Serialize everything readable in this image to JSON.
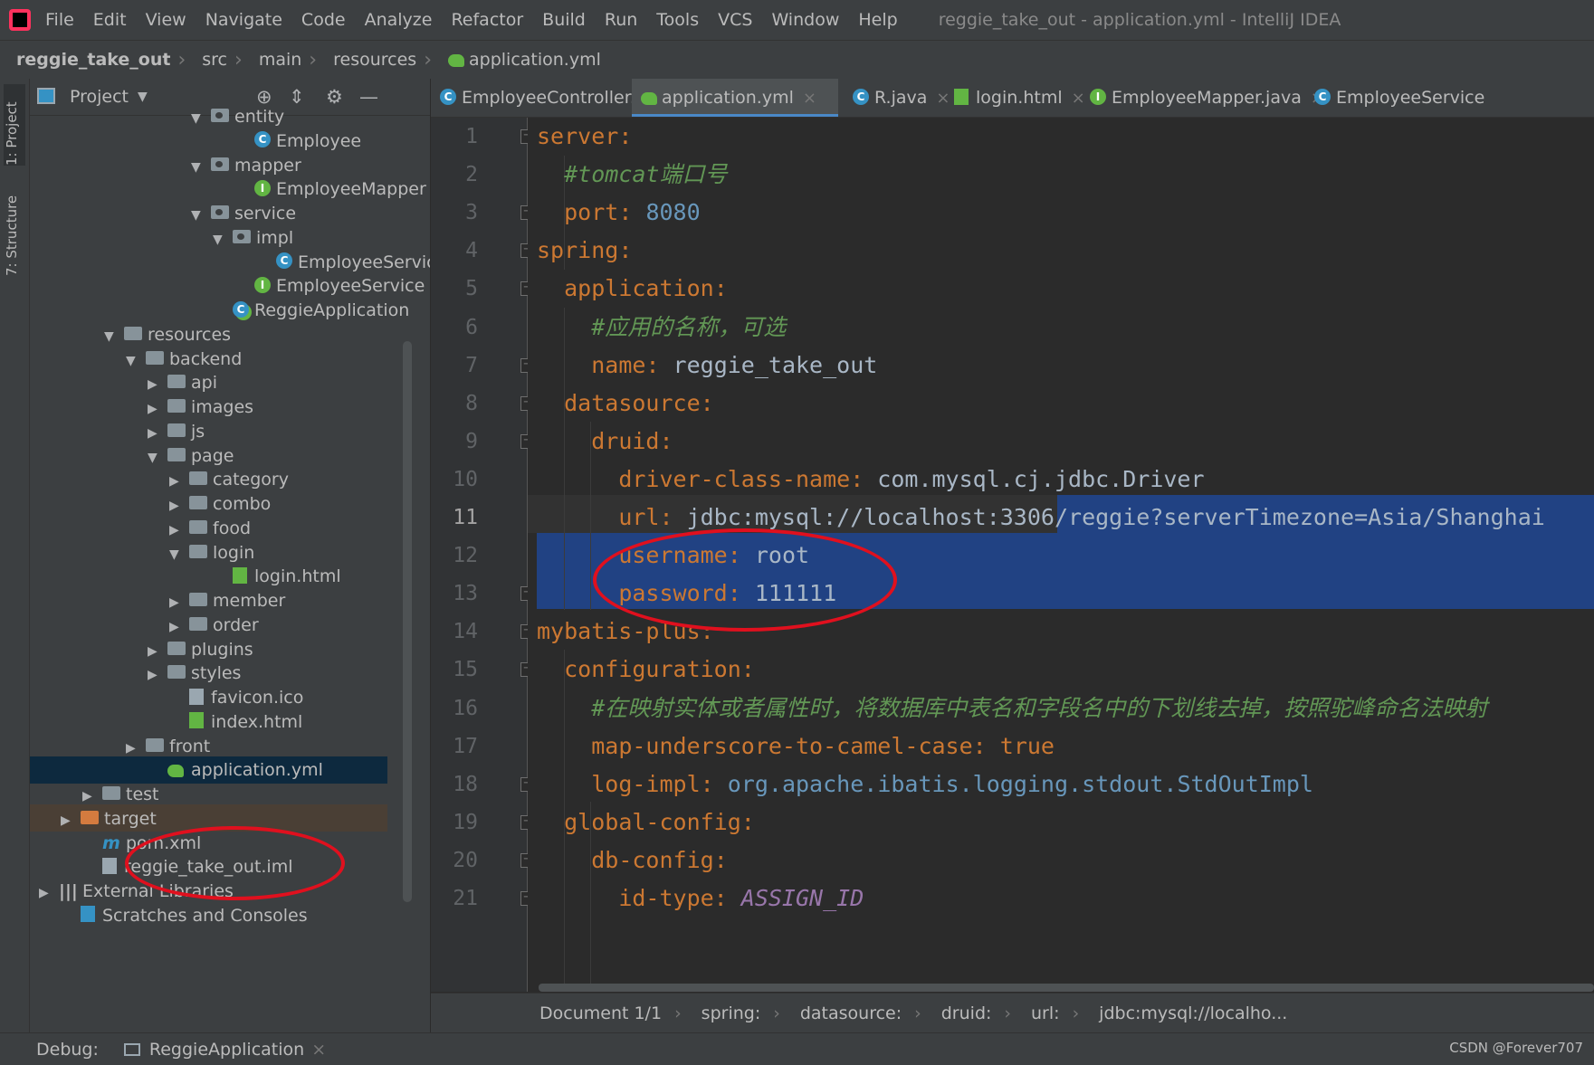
{
  "menubar": {
    "items": [
      "File",
      "Edit",
      "View",
      "Navigate",
      "Code",
      "Analyze",
      "Refactor",
      "Build",
      "Run",
      "Tools",
      "VCS",
      "Window",
      "Help"
    ],
    "window_title": "reggie_take_out - application.yml - IntelliJ IDEA"
  },
  "breadcrumbs": [
    "reggie_take_out",
    "src",
    "main",
    "resources",
    "application.yml"
  ],
  "side_tabs": {
    "project": "1: Project",
    "structure": "7: Structure"
  },
  "project_panel": {
    "title": "Project",
    "tree": [
      {
        "label": "entity",
        "icon": "package-icon",
        "expanded": true
      },
      {
        "label": "Employee",
        "icon": "class-icon"
      },
      {
        "label": "mapper",
        "icon": "package-icon",
        "expanded": true
      },
      {
        "label": "EmployeeMapper",
        "icon": "interface-icon"
      },
      {
        "label": "service",
        "icon": "package-icon",
        "expanded": true
      },
      {
        "label": "impl",
        "icon": "package-icon",
        "expanded": true
      },
      {
        "label": "EmployeeServic",
        "icon": "class-icon"
      },
      {
        "label": "EmployeeService",
        "icon": "interface-icon"
      },
      {
        "label": "ReggieApplication",
        "icon": "spring-class-icon"
      },
      {
        "label": "resources",
        "icon": "folder-icon",
        "expanded": true
      },
      {
        "label": "backend",
        "icon": "folder-icon",
        "expanded": true
      },
      {
        "label": "api",
        "icon": "folder-icon",
        "expanded": false
      },
      {
        "label": "images",
        "icon": "folder-icon",
        "expanded": false
      },
      {
        "label": "js",
        "icon": "folder-icon",
        "expanded": false
      },
      {
        "label": "page",
        "icon": "folder-icon",
        "expanded": true
      },
      {
        "label": "category",
        "icon": "folder-icon",
        "expanded": false
      },
      {
        "label": "combo",
        "icon": "folder-icon",
        "expanded": false
      },
      {
        "label": "food",
        "icon": "folder-icon",
        "expanded": false
      },
      {
        "label": "login",
        "icon": "folder-icon",
        "expanded": true
      },
      {
        "label": "login.html",
        "icon": "html-file-icon"
      },
      {
        "label": "member",
        "icon": "folder-icon",
        "expanded": false
      },
      {
        "label": "order",
        "icon": "folder-icon",
        "expanded": false
      },
      {
        "label": "plugins",
        "icon": "folder-icon",
        "expanded": false
      },
      {
        "label": "styles",
        "icon": "folder-icon",
        "expanded": false
      },
      {
        "label": "favicon.ico",
        "icon": "file-icon"
      },
      {
        "label": "index.html",
        "icon": "html-file-icon"
      },
      {
        "label": "front",
        "icon": "folder-icon",
        "expanded": false
      },
      {
        "label": "application.yml",
        "icon": "yml-icon",
        "selected": true
      },
      {
        "label": "test",
        "icon": "folder-icon",
        "expanded": false
      },
      {
        "label": "target",
        "icon": "folder-icon",
        "expanded": false
      },
      {
        "label": "pom.xml",
        "icon": "maven-icon"
      },
      {
        "label": "reggie_take_out.iml",
        "icon": "iml-file-icon"
      },
      {
        "label": "External Libraries",
        "icon": "libraries-icon",
        "expanded": false
      },
      {
        "label": "Scratches and Consoles",
        "icon": "scratches-icon"
      }
    ]
  },
  "tabs": [
    {
      "label": "EmployeeController.java",
      "icon": "class-icon"
    },
    {
      "label": "application.yml",
      "icon": "yml-icon",
      "active": true
    },
    {
      "label": "R.java",
      "icon": "class-icon"
    },
    {
      "label": "login.html",
      "icon": "html-file-icon"
    },
    {
      "label": "EmployeeMapper.java",
      "icon": "interface-icon"
    },
    {
      "label": "EmployeeService",
      "icon": "class-icon"
    }
  ],
  "editor": {
    "current_line": 11,
    "lines": [
      {
        "n": "1",
        "parts": [
          [
            "k",
            "server"
          ],
          [
            "p",
            ":"
          ]
        ]
      },
      {
        "n": "2",
        "parts": [
          [
            "t",
            "  "
          ],
          [
            "c",
            "#tomcat端口号"
          ]
        ]
      },
      {
        "n": "3",
        "parts": [
          [
            "t",
            "  "
          ],
          [
            "k",
            "port"
          ],
          [
            "p",
            ": "
          ],
          [
            "n",
            "8080"
          ]
        ]
      },
      {
        "n": "4",
        "parts": [
          [
            "k",
            "spring"
          ],
          [
            "p",
            ":"
          ]
        ]
      },
      {
        "n": "5",
        "parts": [
          [
            "t",
            "  "
          ],
          [
            "k",
            "application"
          ],
          [
            "p",
            ":"
          ]
        ]
      },
      {
        "n": "6",
        "parts": [
          [
            "t",
            "    "
          ],
          [
            "c",
            "#应用的名称，可选"
          ]
        ]
      },
      {
        "n": "7",
        "parts": [
          [
            "t",
            "    "
          ],
          [
            "k",
            "name"
          ],
          [
            "p",
            ": "
          ],
          [
            "v",
            "reggie_take_out"
          ]
        ]
      },
      {
        "n": "8",
        "parts": [
          [
            "t",
            "  "
          ],
          [
            "k",
            "datasource"
          ],
          [
            "p",
            ":"
          ]
        ]
      },
      {
        "n": "9",
        "parts": [
          [
            "t",
            "    "
          ],
          [
            "k",
            "druid"
          ],
          [
            "p",
            ":"
          ]
        ]
      },
      {
        "n": "10",
        "parts": [
          [
            "t",
            "      "
          ],
          [
            "k",
            "driver-class-name"
          ],
          [
            "p",
            ": "
          ],
          [
            "v",
            "com.mysql.cj.jdbc.Driver"
          ]
        ]
      },
      {
        "n": "11",
        "parts": [
          [
            "t",
            "      "
          ],
          [
            "k",
            "url"
          ],
          [
            "p",
            ": "
          ],
          [
            "v",
            "jdbc:mysql://localhost:3306/reggie?serverTimezone=Asia/Shanghai"
          ]
        ]
      },
      {
        "n": "12",
        "parts": [
          [
            "t",
            "      "
          ],
          [
            "k",
            "username"
          ],
          [
            "p",
            ": "
          ],
          [
            "v",
            "root"
          ]
        ]
      },
      {
        "n": "13",
        "parts": [
          [
            "t",
            "      "
          ],
          [
            "k",
            "password"
          ],
          [
            "p",
            ": "
          ],
          [
            "v",
            "111111"
          ]
        ]
      },
      {
        "n": "14",
        "parts": [
          [
            "k",
            "mybatis-plus"
          ],
          [
            "p",
            ":"
          ]
        ]
      },
      {
        "n": "15",
        "parts": [
          [
            "t",
            "  "
          ],
          [
            "k",
            "configuration"
          ],
          [
            "p",
            ":"
          ]
        ]
      },
      {
        "n": "16",
        "parts": [
          [
            "t",
            "    "
          ],
          [
            "c",
            "#在映射实体或者属性时，将数据库中表名和字段名中的下划线去掉，按照驼峰命名法映射"
          ]
        ]
      },
      {
        "n": "17",
        "parts": [
          [
            "t",
            "    "
          ],
          [
            "k",
            "map-underscore-to-camel-case"
          ],
          [
            "p",
            ": "
          ],
          [
            "k",
            "true"
          ]
        ]
      },
      {
        "n": "18",
        "parts": [
          [
            "t",
            "    "
          ],
          [
            "k",
            "log-impl"
          ],
          [
            "p",
            ": "
          ],
          [
            "n",
            "org.apache.ibatis.logging.stdout.StdOutImpl"
          ]
        ]
      },
      {
        "n": "19",
        "parts": [
          [
            "t",
            "  "
          ],
          [
            "k",
            "global-config"
          ],
          [
            "p",
            ":"
          ]
        ]
      },
      {
        "n": "20",
        "parts": [
          [
            "t",
            "    "
          ],
          [
            "k",
            "db-config"
          ],
          [
            "p",
            ":"
          ]
        ]
      },
      {
        "n": "21",
        "parts": [
          [
            "t",
            "      "
          ],
          [
            "k",
            "id-type"
          ],
          [
            "p",
            ": "
          ],
          [
            "sv",
            "ASSIGN_ID"
          ]
        ]
      }
    ]
  },
  "editor_breadcrumbs": [
    "Document 1/1",
    "spring:",
    "datasource:",
    "druid:",
    "url:",
    "jdbc:mysql://localho..."
  ],
  "statusbar": {
    "debug_label": "Debug:",
    "run_config": "ReggieApplication"
  },
  "watermark": "CSDN @Forever707",
  "colors": {
    "keyword": "#cc7832",
    "comment": "#629755",
    "number": "#6897bb",
    "text": "#a9b7c6",
    "selection": "#214283",
    "annotation": "#e0101e"
  }
}
